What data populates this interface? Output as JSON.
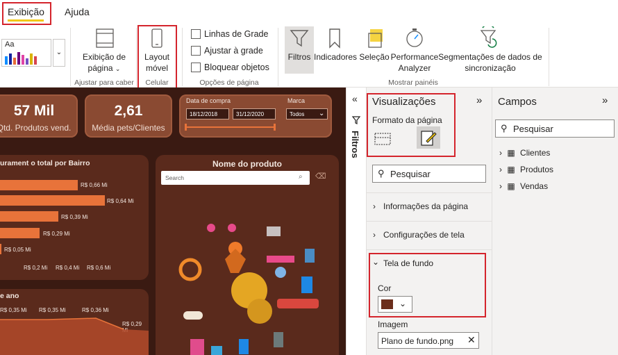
{
  "tabs": {
    "active": "Exibição",
    "other": "Ajuda"
  },
  "ribbon": {
    "theme_label": "Aa",
    "page_view": {
      "line1": "Exibição de",
      "line2": "página"
    },
    "fit_width_group": "Ajustar para caber",
    "mobile_layout": {
      "line1": "Layout",
      "line2": "móvel"
    },
    "phone_group": "Celular",
    "gridlines": "Linhas de Grade",
    "snap_to_grid": "Ajustar à grade",
    "lock_objects": "Bloquear objetos",
    "page_options_group": "Opções de página",
    "filters": "Filtros",
    "bookmarks": "Indicadores",
    "selection": "Seleção",
    "performance": {
      "line1": "Performance",
      "line2": "Analyzer"
    },
    "sync_slicers": {
      "line1": "Segmentações de dados de",
      "line2": "sincronização"
    },
    "show_panes_group": "Mostrar painéis"
  },
  "canvas": {
    "kpi1": {
      "value": "57 Mil",
      "label": "Qtd. Produtos vend."
    },
    "kpi2": {
      "value": "2,61",
      "label": "Média pets/Clientes"
    },
    "date_filter": {
      "label": "Data de compra",
      "start": "18/12/2018",
      "end": "31/12/2020"
    },
    "brand_filter": {
      "label": "Marca",
      "value": "Todos"
    },
    "revenue_chart": {
      "title": "urament o total por Bairro",
      "bar_labels": [
        "R$ 0,66 Mi",
        "R$ 0,64 Mi",
        "R$ 0,39 Mi",
        "R$ 0,29 Mi",
        "R$ 0,05 Mi"
      ],
      "axis": [
        "R$ 0,2 Mi",
        "R$ 0,4 Mi",
        "R$ 0,6 Mi"
      ]
    },
    "product_panel": {
      "title": "Nome do produto",
      "search_placeholder": "Search"
    },
    "year_chart": {
      "title": "e ano",
      "labels": [
        "R$ 0,35 Mi",
        "R$ 0,35 Mi",
        "R$ 0,36 Mi",
        "R$ 0,29 Mi"
      ]
    }
  },
  "filters_strip": {
    "label": "Filtros"
  },
  "viz_pane": {
    "title": "Visualizações",
    "subtitle": "Formato da página",
    "search": "Pesquisar",
    "sections": [
      "Informações da página",
      "Configurações de tela",
      "Tela de fundo"
    ],
    "color_label": "Cor",
    "color_value": "#6b2e1c",
    "image_label": "Imagem",
    "image_value": "Plano de fundo.png"
  },
  "fields_pane": {
    "title": "Campos",
    "search": "Pesquisar",
    "tables": [
      "Clientes",
      "Produtos",
      "Vendas"
    ]
  },
  "colors": {
    "accent": "#f2c811",
    "highlight": "#d4242c",
    "canvas_bg": "#3a1a12",
    "bar": "#e8733a"
  }
}
